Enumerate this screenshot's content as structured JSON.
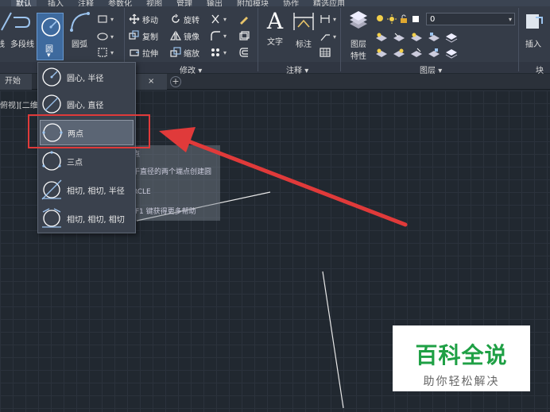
{
  "menu_tabs": [
    "默认",
    "插入",
    "注释",
    "参数化",
    "视图",
    "管理",
    "输出",
    "附加模块",
    "协作",
    "精选应用"
  ],
  "ribbon": {
    "draw": {
      "line_label": "线",
      "polyline_label": "多段线",
      "circle_label": "圆",
      "arc_label": "圆弧"
    },
    "modify": {
      "title": "修改",
      "move": "移动",
      "rotate": "旋转",
      "copy": "复制",
      "mirror": "镜像",
      "stretch": "拉伸",
      "scale": "缩放"
    },
    "annotation": {
      "title": "注释",
      "text": "文字",
      "dimension": "标注"
    },
    "layers": {
      "title": "图层",
      "layer_properties_line1": "图层",
      "layer_properties_line2": "特性",
      "current_layer": "0"
    },
    "block": {
      "title": "块",
      "insert": "插入"
    },
    "dropdown_caret": "▾"
  },
  "circle_menu": {
    "items": [
      {
        "label": "圆心, 半径",
        "icon": "circle-center-radius-icon"
      },
      {
        "label": "圆心, 直径",
        "icon": "circle-center-diameter-icon"
      },
      {
        "label": "两点",
        "icon": "circle-two-point-icon"
      },
      {
        "label": "三点",
        "icon": "circle-three-point-icon"
      },
      {
        "label": "相切, 相切, 半径",
        "icon": "circle-ttr-icon"
      },
      {
        "label": "相切, 相切, 相切",
        "icon": "circle-ttt-icon"
      }
    ]
  },
  "doc_tabs": {
    "start": "开始",
    "close_glyph": "×",
    "add_glyph": "+"
  },
  "viewport_label": "俯视][二维",
  "tooltip": {
    "line1": "两点",
    "line2": "基于直径的两个端点创建圆",
    "line3": "CIRCLE",
    "line4": "按 F1 键获得更多帮助"
  },
  "watermark": {
    "main": "百科全说",
    "sub": "助你轻松解决"
  },
  "colors": {
    "annotation_red": "#e03a3a",
    "watermark_green": "#1fa045",
    "highlight_blue": "#3e6a9e"
  }
}
